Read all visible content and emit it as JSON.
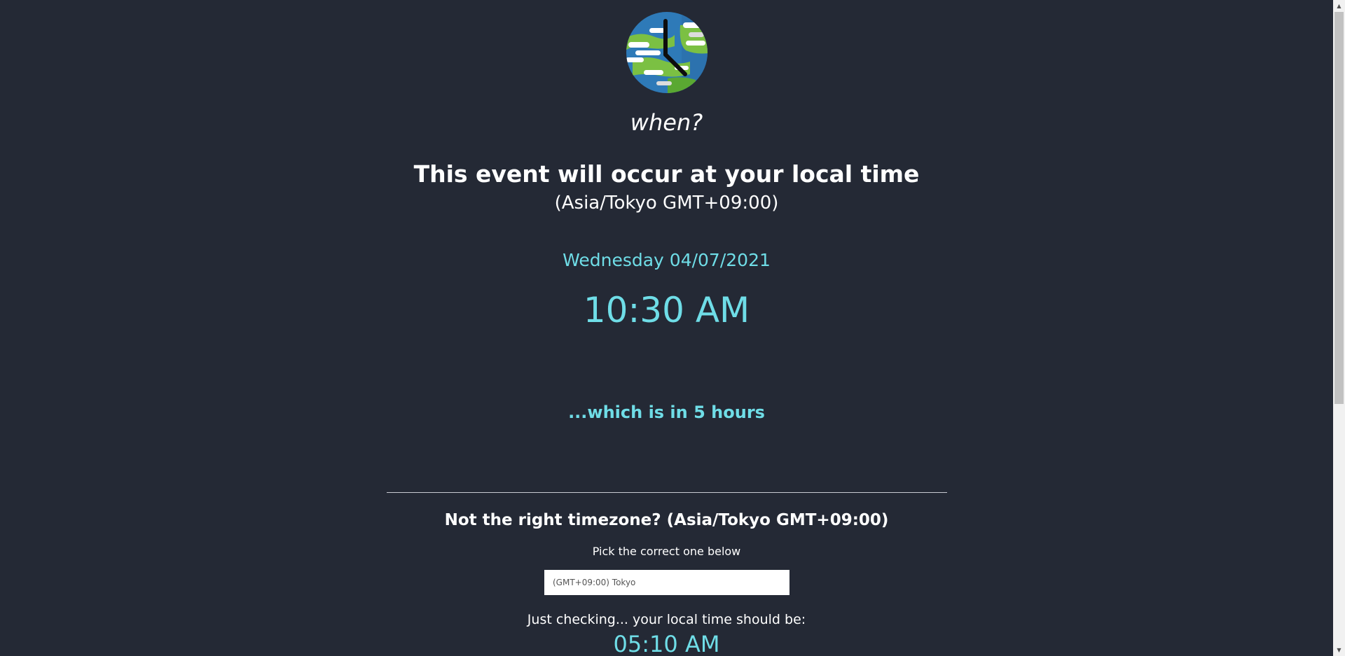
{
  "app": {
    "brand": "when?",
    "logo_icon": "globe-clock-icon"
  },
  "event": {
    "headline": "This event will occur at your local time",
    "timezone_label": "(Asia/Tokyo GMT+09:00)",
    "date": "Wednesday 04/07/2021",
    "time": "10:30 AM",
    "relative": "...which is in 5 hours"
  },
  "timezone_picker": {
    "question": "Not the right timezone? (Asia/Tokyo GMT+09:00)",
    "instruction": "Pick the correct one below",
    "selected_value": "(GMT+09:00) Tokyo",
    "checking_label": "Just checking... your local time should be:",
    "local_time": "05:10 AM"
  },
  "colors": {
    "background": "#242935",
    "accent": "#6fdde7",
    "text": "#ffffff"
  },
  "scrollbar": {
    "up_icon": "scroll-up-arrow-icon",
    "down_icon": "scroll-down-arrow-icon"
  }
}
